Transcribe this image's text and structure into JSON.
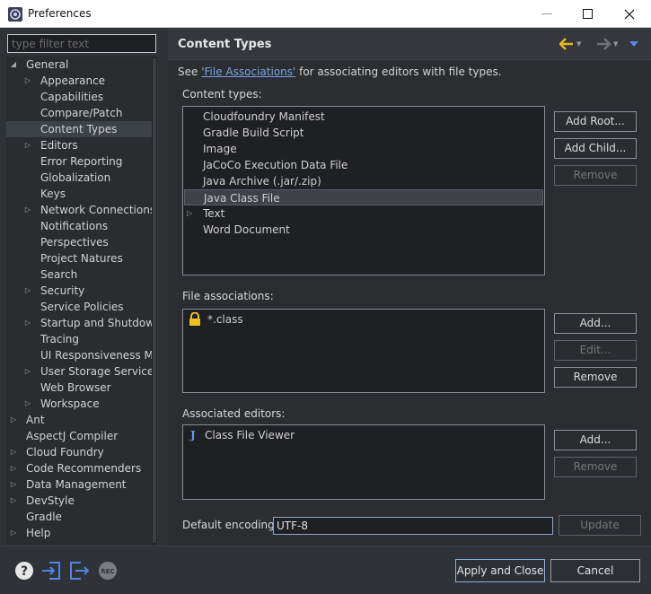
{
  "window": {
    "title": "Preferences"
  },
  "filter": {
    "placeholder": "type filter text"
  },
  "tree": [
    {
      "label": "General",
      "expander": "expanded",
      "level": 0
    },
    {
      "label": "Appearance",
      "expander": "collapsed",
      "level": 1
    },
    {
      "label": "Capabilities",
      "expander": "none",
      "level": 1
    },
    {
      "label": "Compare/Patch",
      "expander": "none",
      "level": 1
    },
    {
      "label": "Content Types",
      "expander": "none",
      "level": 1,
      "selected": true
    },
    {
      "label": "Editors",
      "expander": "collapsed",
      "level": 1
    },
    {
      "label": "Error Reporting",
      "expander": "none",
      "level": 1
    },
    {
      "label": "Globalization",
      "expander": "none",
      "level": 1
    },
    {
      "label": "Keys",
      "expander": "none",
      "level": 1
    },
    {
      "label": "Network Connections",
      "expander": "collapsed",
      "level": 1
    },
    {
      "label": "Notifications",
      "expander": "none",
      "level": 1
    },
    {
      "label": "Perspectives",
      "expander": "none",
      "level": 1
    },
    {
      "label": "Project Natures",
      "expander": "none",
      "level": 1
    },
    {
      "label": "Search",
      "expander": "none",
      "level": 1
    },
    {
      "label": "Security",
      "expander": "collapsed",
      "level": 1
    },
    {
      "label": "Service Policies",
      "expander": "none",
      "level": 1
    },
    {
      "label": "Startup and Shutdown",
      "expander": "collapsed",
      "level": 1
    },
    {
      "label": "Tracing",
      "expander": "none",
      "level": 1
    },
    {
      "label": "UI Responsiveness Mor",
      "expander": "none",
      "level": 1
    },
    {
      "label": "User Storage Service",
      "expander": "collapsed",
      "level": 1
    },
    {
      "label": "Web Browser",
      "expander": "none",
      "level": 1
    },
    {
      "label": "Workspace",
      "expander": "collapsed",
      "level": 1
    },
    {
      "label": "Ant",
      "expander": "collapsed",
      "level": 0
    },
    {
      "label": "AspectJ Compiler",
      "expander": "none",
      "level": 0
    },
    {
      "label": "Cloud Foundry",
      "expander": "collapsed",
      "level": 0
    },
    {
      "label": "Code Recommenders",
      "expander": "collapsed",
      "level": 0
    },
    {
      "label": "Data Management",
      "expander": "collapsed",
      "level": 0
    },
    {
      "label": "DevStyle",
      "expander": "collapsed",
      "level": 0
    },
    {
      "label": "Gradle",
      "expander": "none",
      "level": 0
    },
    {
      "label": "Help",
      "expander": "collapsed",
      "level": 0
    }
  ],
  "page": {
    "title": "Content Types",
    "desc_before": "See ",
    "desc_link": "'File Associations'",
    "desc_after": " for associating editors with file types."
  },
  "content_types": {
    "label": "Content types:",
    "items": [
      {
        "label": "Cloudfoundry Manifest",
        "expander": "none"
      },
      {
        "label": "Gradle Build Script",
        "expander": "none"
      },
      {
        "label": "Image",
        "expander": "none"
      },
      {
        "label": "JaCoCo Execution Data File",
        "expander": "none"
      },
      {
        "label": "Java Archive (.jar/.zip)",
        "expander": "none"
      },
      {
        "label": "Java Class File",
        "expander": "none",
        "selected": true
      },
      {
        "label": "Text",
        "expander": "collapsed"
      },
      {
        "label": "Word Document",
        "expander": "none"
      }
    ],
    "buttons": {
      "add_root": "Add Root...",
      "add_child": "Add Child...",
      "remove": "Remove"
    }
  },
  "file_associations": {
    "label": "File associations:",
    "items": [
      {
        "label": "*.class",
        "icon": "lock-icon"
      }
    ],
    "buttons": {
      "add": "Add...",
      "edit": "Edit...",
      "remove": "Remove"
    }
  },
  "associated_editors": {
    "label": "Associated editors:",
    "items": [
      {
        "label": "Class File Viewer",
        "icon": "java-icon"
      }
    ],
    "buttons": {
      "add": "Add...",
      "remove": "Remove"
    }
  },
  "encoding": {
    "label": "Default encoding:",
    "value": "UTF-8",
    "update": "Update"
  },
  "footer": {
    "apply_close": "Apply and Close",
    "cancel": "Cancel",
    "icons": [
      "help-icon",
      "import-icon",
      "export-icon",
      "record-icon"
    ],
    "record_text": "REC"
  },
  "colors": {
    "accent_link": "#76a3e8",
    "back_arrow": "#e7b528",
    "lock": "#f0c020",
    "java_j": "#6f8fe8",
    "footer_icons": "#4f86e6"
  }
}
